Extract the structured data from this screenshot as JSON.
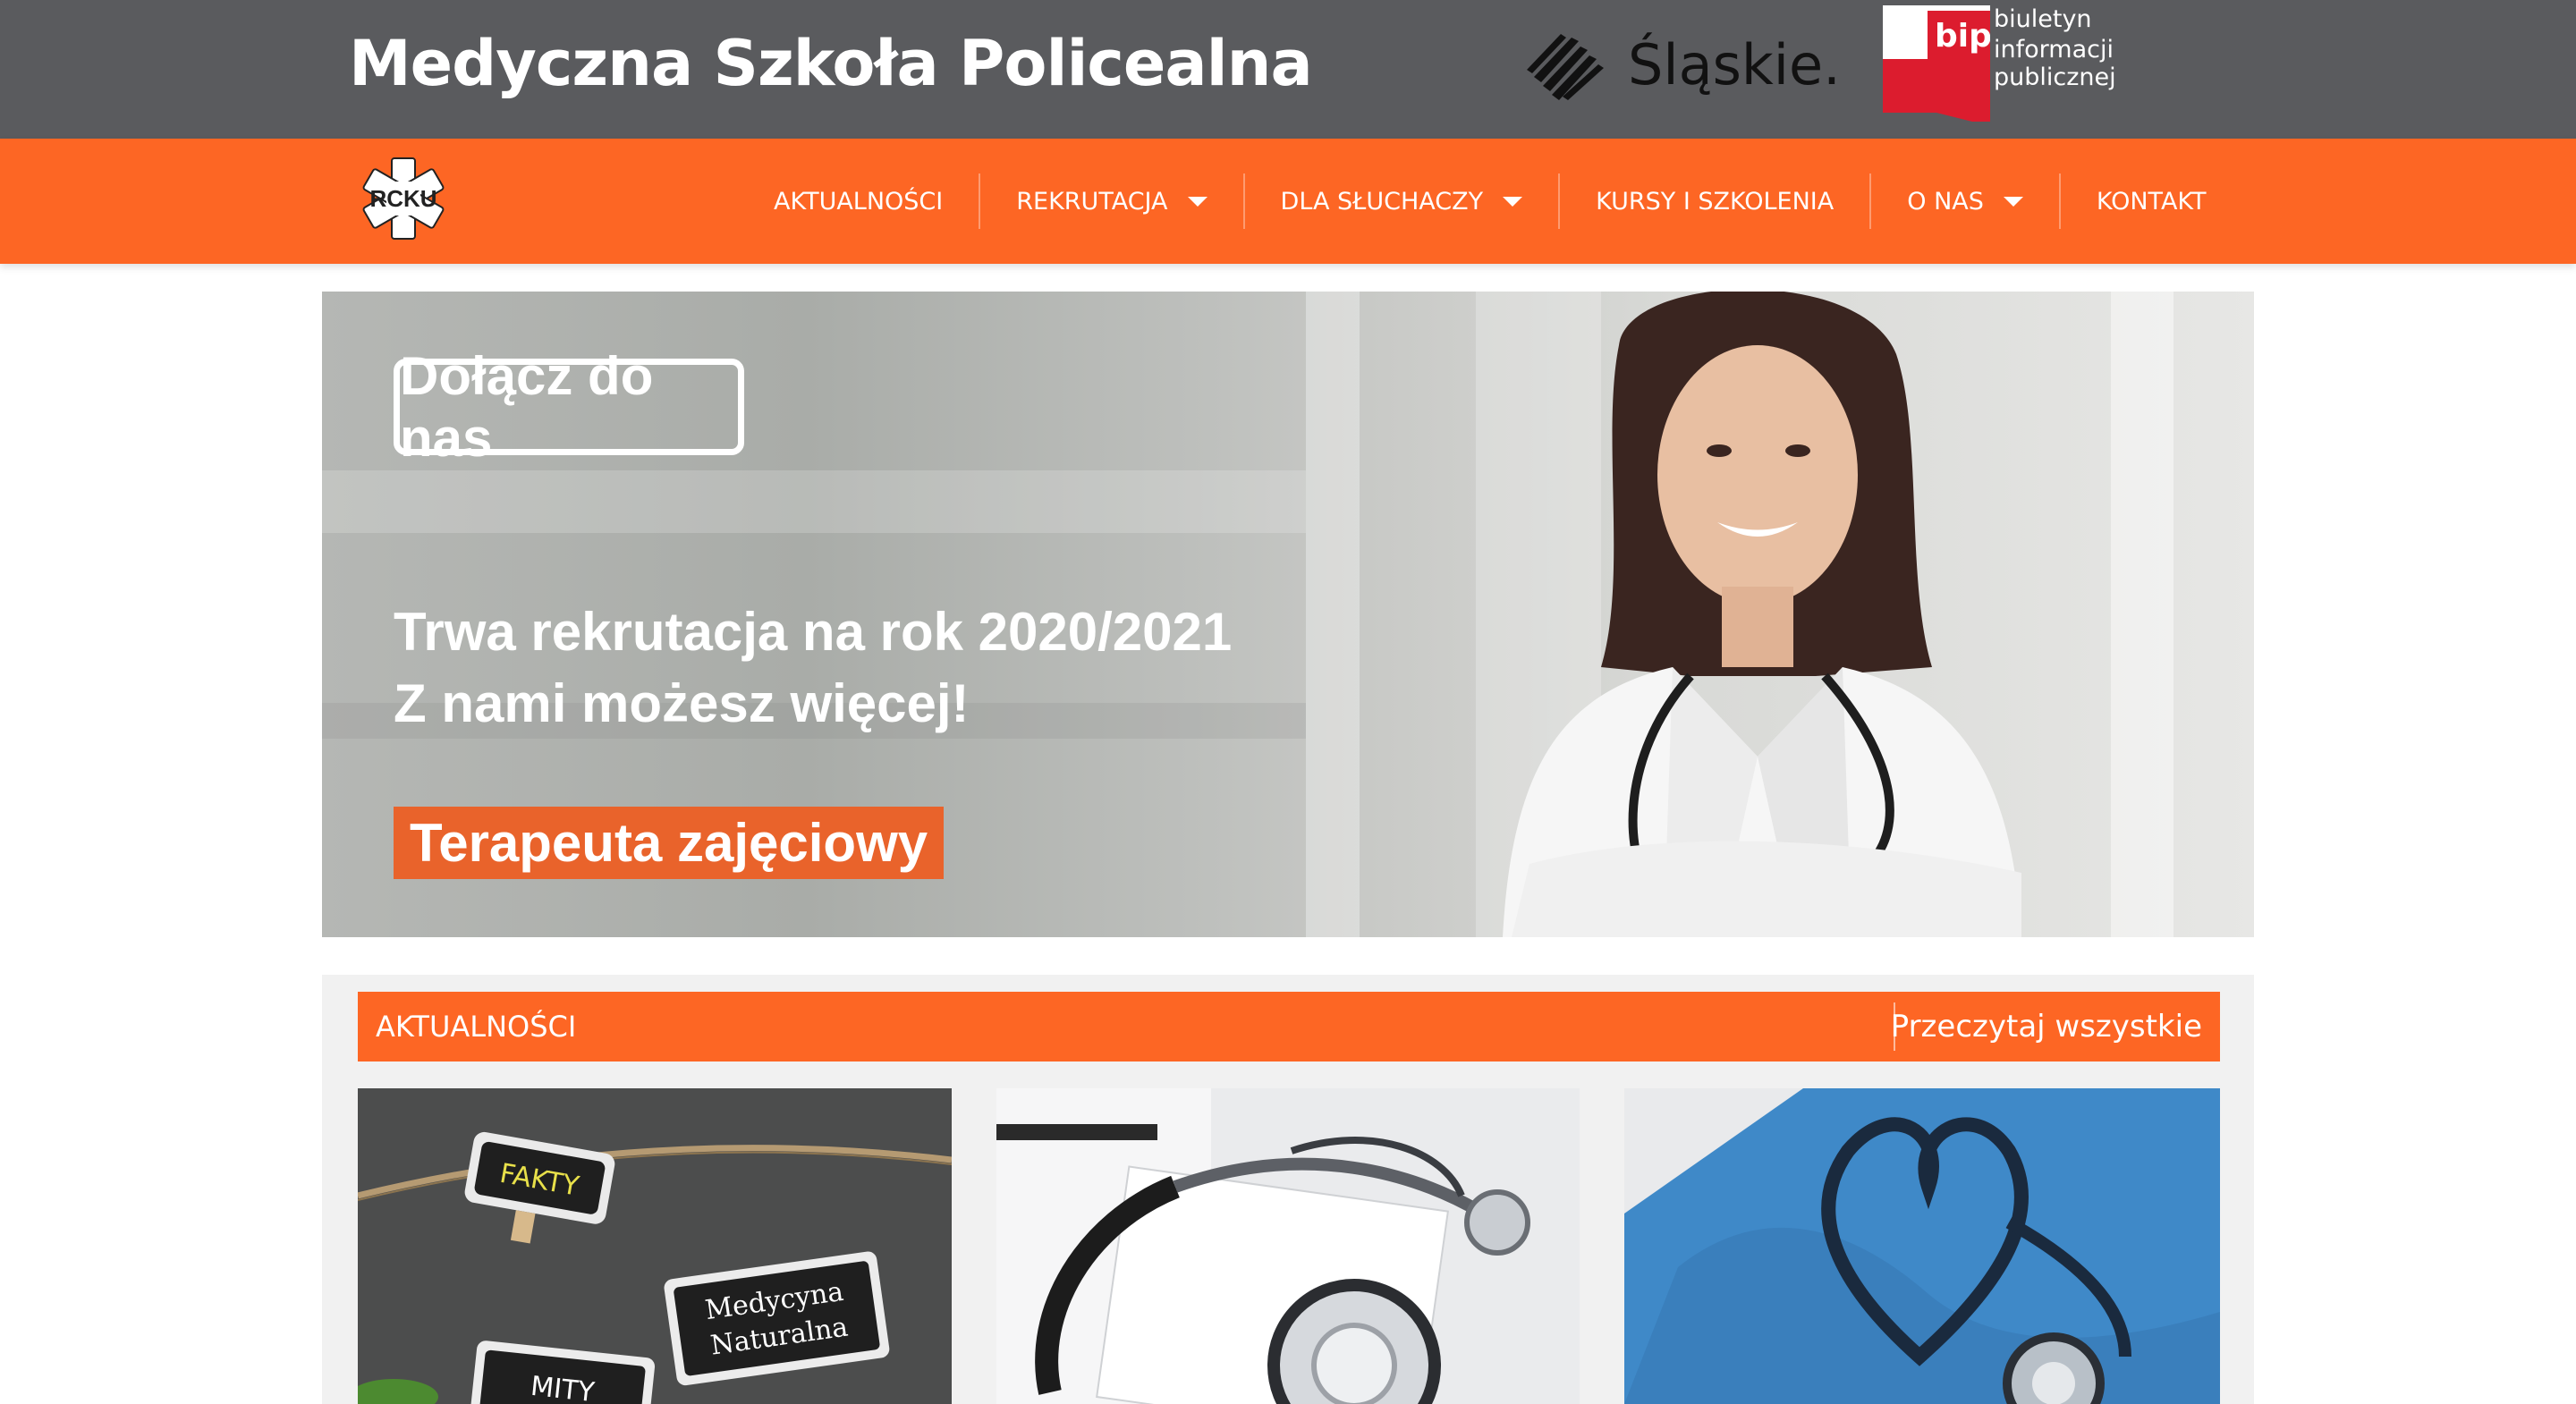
{
  "header": {
    "site_title": "Medyczna Szkoła Policealna",
    "slaskie_label": "Śląskie.",
    "bip_mark": "bip",
    "bip_line1": "biuletyn",
    "bip_line2": "informacji publicznej"
  },
  "logo": {
    "text": "RCKU"
  },
  "nav": {
    "items": [
      {
        "label": "AKTUALNOŚCI",
        "dropdown": false
      },
      {
        "label": "REKRUTACJA",
        "dropdown": true
      },
      {
        "label": "DLA SŁUCHACZY",
        "dropdown": true
      },
      {
        "label": "KURSY I SZKOLENIA",
        "dropdown": false
      },
      {
        "label": "O NAS",
        "dropdown": true
      },
      {
        "label": "KONTAKT",
        "dropdown": false
      }
    ]
  },
  "hero": {
    "join_button": "Dołącz do nas",
    "line1": "Trwa rekrutacja na rok 2020/2021",
    "line2": "Z nami możesz więcej!",
    "badge": "Terapeuta zajęciowy"
  },
  "news": {
    "title": "AKTUALNOŚCI",
    "read_all": "Przeczytaj wszystkie",
    "cards": [
      {
        "tag1": "FAKTY",
        "tag2": "Medycyna",
        "tag3": "Naturalna",
        "tag4": "MITY"
      },
      {
        "image": "stethoscope-clipboard"
      },
      {
        "image": "stethoscope-heart-scrubs"
      }
    ]
  },
  "colors": {
    "topbar": "#5a5b5e",
    "nav_orange": "#fd6624",
    "badge_orange": "#e9632b",
    "bip_red": "#dc1c2e"
  }
}
